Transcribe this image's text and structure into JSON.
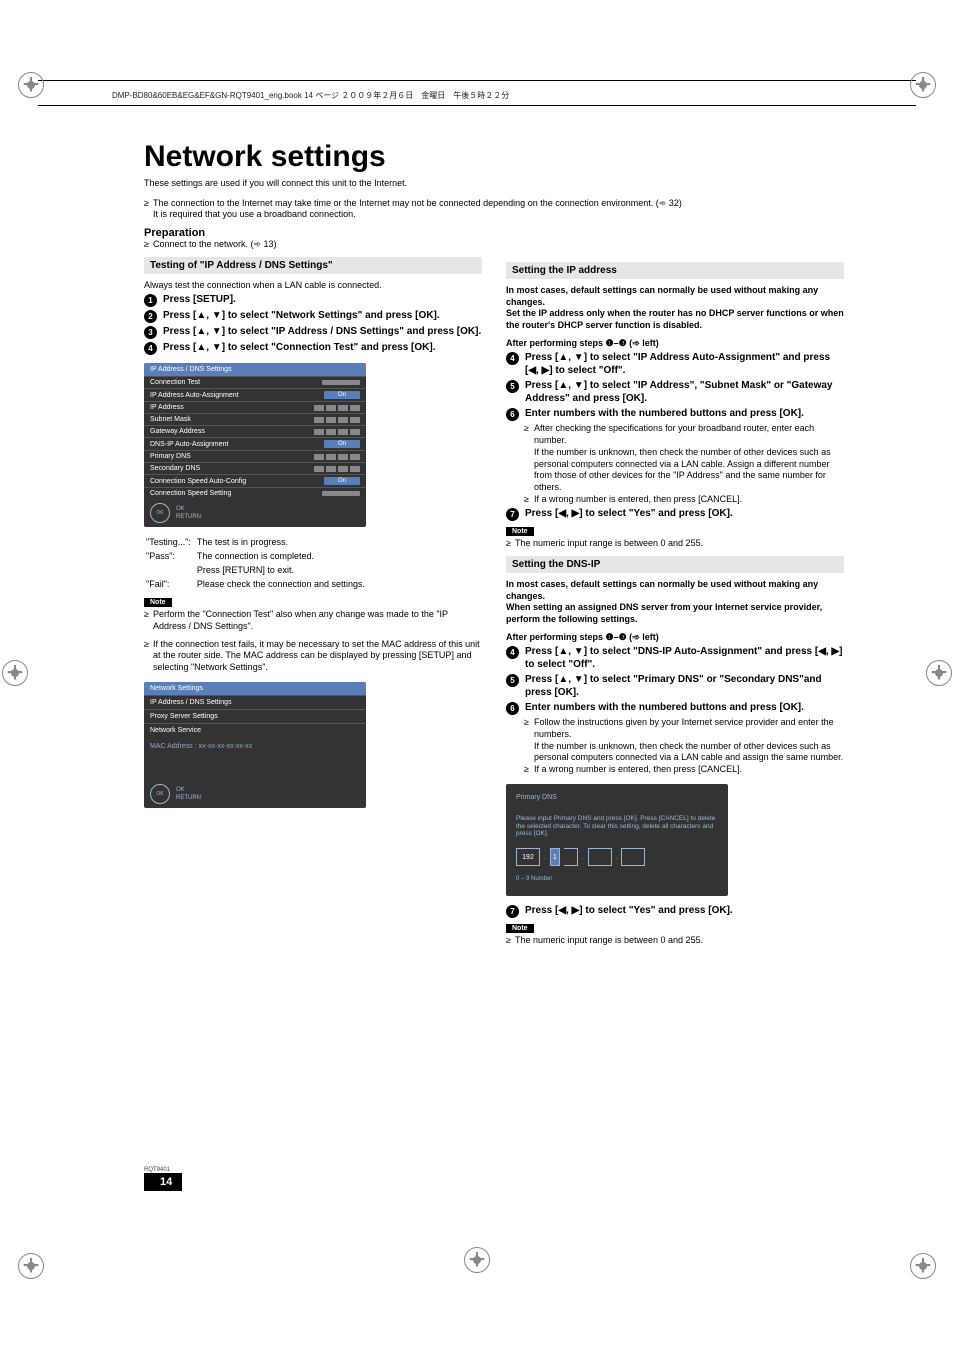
{
  "header_path": "DMP-BD80&60EB&EG&EF&GN-RQT9401_eng.book  14 ページ  ２００９年２月６日　金曜日　午後５時２２分",
  "title": "Network settings",
  "intro_line": "These settings are used if you will connect this unit to the Internet.",
  "intro_bullet1": "The connection to the Internet may take time or the Internet may not be connected depending on the connection environment. (➾ 32)\nIt is required that you use a broadband connection.",
  "preparation_title": "Preparation",
  "preparation_bullet": "Connect to the network. (➾ 13)",
  "left": {
    "section_title": "Testing of \"IP Address / DNS Settings\"",
    "lead": "Always test the connection when a LAN cable is connected.",
    "step1": "Press [SETUP].",
    "step2": "Press [▲, ▼] to select \"Network Settings\" and press [OK].",
    "step3": "Press [▲, ▼] to select \"IP Address / DNS Settings\" and press [OK].",
    "step4": "Press [▲, ▼] to select \"Connection Test\" and press [OK].",
    "panel_title": "IP Address / DNS Settings",
    "rows": {
      "r1": "Connection Test",
      "r2": "IP Address Auto-Assignment",
      "r2v": "On",
      "r3": "IP Address",
      "r4": "Subnet Mask",
      "r5": "Gateway Address",
      "r6": "DNS-IP Auto-Assignment",
      "r6v": "On",
      "r7": "Primary DNS",
      "r8": "Secondary DNS",
      "r9": "Connection Speed Auto-Config",
      "r9v": "On",
      "r10": "Connection Speed Setting"
    },
    "panel_ok": "OK",
    "panel_return": "RETURN",
    "status_testing_k": "\"Testing...\":",
    "status_testing_v": "The test is in progress.",
    "status_pass_k": "\"Pass\":",
    "status_pass_v1": "The connection is completed.",
    "status_pass_v2": "Press [RETURN] to exit.",
    "status_fail_k": "\"Fail\":",
    "status_fail_v": "Please check the connection and settings.",
    "note1": "Perform the \"Connection Test\" also when any change was made to the \"IP Address / DNS Settings\".",
    "note2": "If the connection test fails, it may be necessary to set the MAC address of this unit at the router side. The MAC address can be displayed by pressing [SETUP] and selecting \"Network Settings\".",
    "net_panel_title": "Network Settings",
    "net_r1": "IP Address / DNS Settings",
    "net_r2": "Proxy Server Settings",
    "net_r3": "Network Service",
    "mac": "MAC Address : xx-xx-xx-xx-xx-xx"
  },
  "right": {
    "sec1_title": "Setting the IP address",
    "sec1_p1": "In most cases, default settings can normally be used without making any changes.",
    "sec1_p2": "Set the IP address only when the router has no DHCP server functions or when the router's DHCP server function is disabled.",
    "after": "After performing steps ❶–❸ (➾ left)",
    "s1_step4": "Press [▲, ▼] to select \"IP Address Auto-Assignment\" and press [◀, ▶] to select \"Off\".",
    "s1_step5": "Press [▲, ▼] to select \"IP Address\", \"Subnet Mask\" or \"Gateway Address\" and press [OK].",
    "s1_step6": "Enter numbers with the numbered buttons and press [OK].",
    "s1_sub1": "After checking the specifications for your broadband router, enter each number.\nIf the number is unknown, then check the number of other devices such as personal computers connected via a LAN cable. Assign a different number from those of other devices for the \"IP Address\" and the same number for others.",
    "s1_sub2": "If a wrong number is entered, then press [CANCEL].",
    "s1_step7": "Press [◀, ▶] to select \"Yes\" and press [OK].",
    "s1_note": "The numeric input range is between 0 and 255.",
    "sec2_title": "Setting the DNS-IP",
    "sec2_p1": "In most cases, default settings can normally be used without making any changes.",
    "sec2_p2": "When setting an assigned DNS server from your Internet service provider, perform the following settings.",
    "s2_step4": "Press [▲, ▼] to select \"DNS-IP Auto-Assignment\" and press [◀, ▶] to select \"Off\".",
    "s2_step5": "Press [▲, ▼] to select \"Primary DNS\" or \"Secondary DNS\"and press [OK].",
    "s2_step6": "Enter numbers with the numbered buttons and press [OK].",
    "s2_sub1": "Follow the instructions given by your Internet service provider and enter the numbers.\nIf the number is unknown, then check the number of other devices such as personal computers connected via a LAN cable and assign the same number.",
    "s2_sub2": "If a wrong number is entered, then press [CANCEL].",
    "dns_panel_title": "Primary DNS",
    "dns_msg": "Please input Primary DNS and press [OK]. Press [CANCEL] to delete the selected character. To clear this setting, delete all characters and press [OK].",
    "dns_v1": "192",
    "dns_v2": "1",
    "dns_num": "0 – 9  Number",
    "s2_step7": "Press [◀, ▶] to select \"Yes\" and press [OK].",
    "s2_note": "The numeric input range is between 0 and 255."
  },
  "note_label": "Note",
  "page_number": "14",
  "rqt": "RQT9401"
}
